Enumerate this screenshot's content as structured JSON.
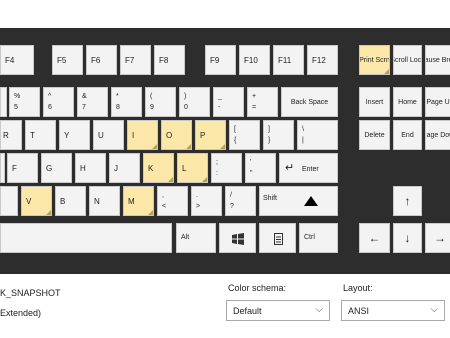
{
  "colors": {
    "panel": "#2d2d2d",
    "key": "#f3f3f3",
    "highlight": "#fbe7a8"
  },
  "keys": {
    "f4": "F4",
    "f5": "F5",
    "f6": "F6",
    "f7": "F7",
    "f8": "F8",
    "f9": "F9",
    "f10": "F10",
    "f11": "F11",
    "f12": "F12",
    "prtsc": "Print Scrn",
    "scroll": "Scroll Lock",
    "pause": "Pause Break",
    "k5_top": "%",
    "k5_bot": "5",
    "k6_top": "^",
    "k6_bot": "6",
    "k7_top": "&",
    "k7_bot": "7",
    "k8_top": "*",
    "k8_bot": "8",
    "k9_top": "(",
    "k9_bot": "9",
    "k0_top": ")",
    "k0_bot": "0",
    "minus_top": "_",
    "minus_bot": "-",
    "equal_top": "+",
    "equal_bot": "=",
    "backspace": "Back Space",
    "insert": "Insert",
    "home": "Home",
    "pgup": "Page Up",
    "r": "R",
    "t": "T",
    "y": "Y",
    "u": "U",
    "i": "I",
    "o": "O",
    "p": "P",
    "lbr_top": "[",
    "lbr_bot": "{",
    "rbr_top": "]",
    "rbr_bot": "}",
    "bsl_top": "\\",
    "bsl_bot": "|",
    "delete": "Delete",
    "end": "End",
    "pgdn": "Page Down",
    "f": "F",
    "g": "G",
    "h": "H",
    "j": "J",
    "k": "K",
    "l": "L",
    "semi_top": ";",
    "semi_bot": ":",
    "quote_top": "'",
    "quote_bot": "\"",
    "enter": "Enter",
    "v": "V",
    "b": "B",
    "n": "N",
    "m": "M",
    "comma_top": ",",
    "comma_bot": "<",
    "period_top": ".",
    "period_bot": ">",
    "slash_top": "/",
    "slash_bot": "?",
    "shift": "Shift",
    "alt": "Alt",
    "ctrl": "Ctrl",
    "up": "↑",
    "left": "←",
    "down": "↓",
    "right": "→"
  },
  "footer": {
    "snapshot_name": "K_SNAPSHOT",
    "snapshot_sub": "Extended)",
    "color_schema_label": "Color schema:",
    "color_schema_value": "Default",
    "layout_label": "Layout:",
    "layout_value": "ANSI"
  }
}
